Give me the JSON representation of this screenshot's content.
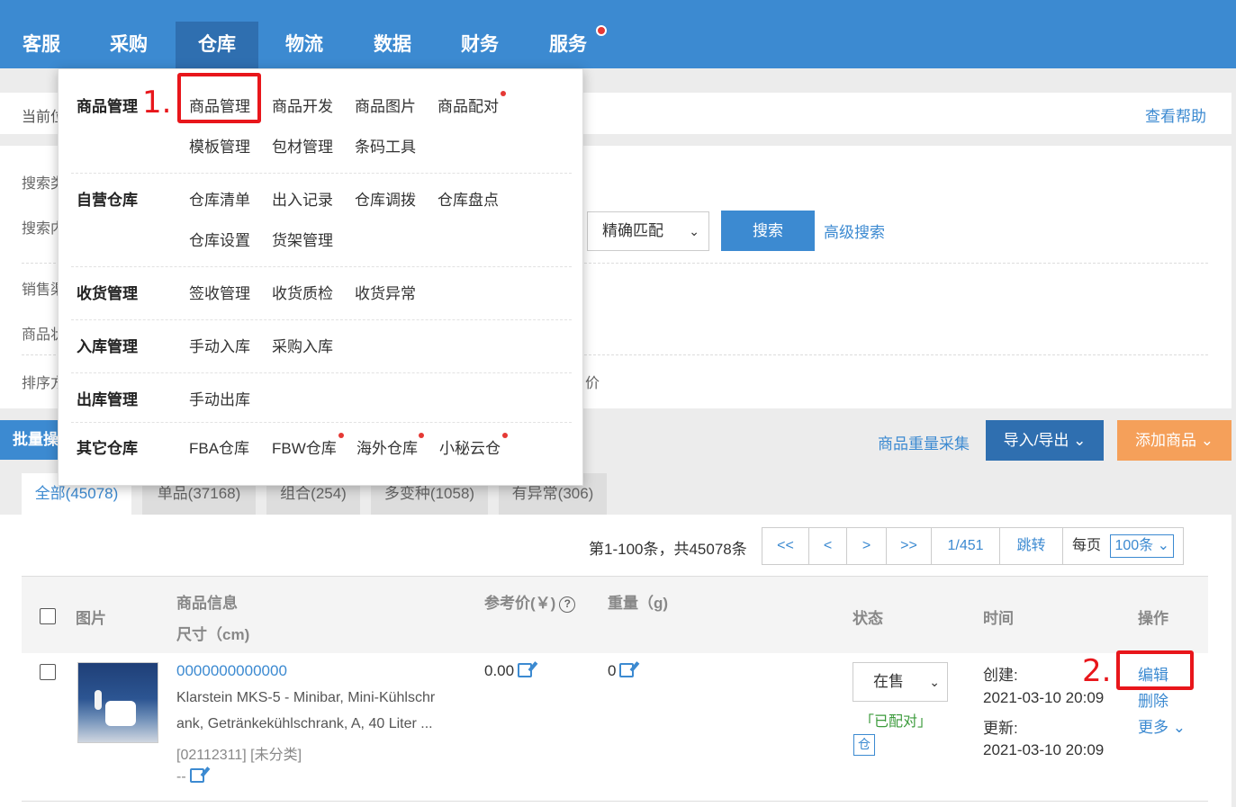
{
  "topnav": {
    "items": [
      "客服",
      "采购",
      "仓库",
      "物流",
      "数据",
      "财务",
      "服务"
    ],
    "active": "仓库"
  },
  "breadcrumb": {
    "left": "当前位",
    "help": "查看帮助"
  },
  "search": {
    "labels": [
      "搜索类",
      "搜索内",
      "销售渠",
      "商品状",
      "排序方"
    ],
    "match_select": "精确匹配",
    "search_button": "搜索",
    "advanced": "高级搜索",
    "price_fragment": "价"
  },
  "toolbar": {
    "bulk": "批量操",
    "weight_collect": "商品重量采集",
    "import_export": "导入/导出",
    "add_product": "添加商品"
  },
  "tabs": [
    "全部(45078)",
    "单品(37168)",
    "组合(254)",
    "多变种(1058)",
    "有异常(306)"
  ],
  "pager": {
    "info": "第1-100条，共45078条",
    "first": "<<",
    "prev": "<",
    "next": ">",
    "last": ">>",
    "page": "1/451",
    "jump": "跳转",
    "per_page_label": "每页",
    "per_page_value": "100条"
  },
  "table": {
    "headers": {
      "image": "图片",
      "info": "商品信息",
      "size": "尺寸（cm)",
      "ref_price": "参考价(￥)",
      "weight": "重量（g)",
      "status": "状态",
      "time": "时间",
      "ops": "操作"
    },
    "row": {
      "sku": "0000000000000",
      "title_1": "Klarstein MKS-5 - Minibar, Mini-Kühlschr",
      "title_2": "ank, Getränkekühlschrank, A, 40 Liter ...",
      "code": "[02112311] [未分类]",
      "size": "--",
      "price": "0.00",
      "weight": "0",
      "status": "在售",
      "matched": "「已配对」",
      "warehouse_icon": "仓",
      "created_label": "创建:",
      "created": "2021-03-10 20:09",
      "updated_label": "更新:",
      "updated": "2021-03-10 20:09",
      "edit": "编辑",
      "delete": "删除",
      "more": "更多"
    }
  },
  "menu": {
    "groups": [
      {
        "title": "商品管理",
        "links": [
          "商品管理",
          "商品开发",
          "商品图片",
          "商品配对",
          "模板管理",
          "包材管理",
          "条码工具"
        ]
      },
      {
        "title": "自营仓库",
        "links": [
          "仓库清单",
          "出入记录",
          "仓库调拨",
          "仓库盘点",
          "仓库设置",
          "货架管理"
        ]
      },
      {
        "title": "收货管理",
        "links": [
          "签收管理",
          "收货质检",
          "收货异常"
        ]
      },
      {
        "title": "入库管理",
        "links": [
          "手动入库",
          "采购入库"
        ]
      },
      {
        "title": "出库管理",
        "links": [
          "手动出库"
        ]
      },
      {
        "title": "其它仓库",
        "links": [
          "FBA仓库",
          "FBW仓库",
          "海外仓库",
          "小秘云仓"
        ]
      }
    ]
  },
  "annotations": {
    "step1": "1.",
    "step2": "2."
  },
  "colors": {
    "brand": "#3c8ad1",
    "accent_orange": "#f5a05a",
    "annotation_red": "#e8161b"
  }
}
